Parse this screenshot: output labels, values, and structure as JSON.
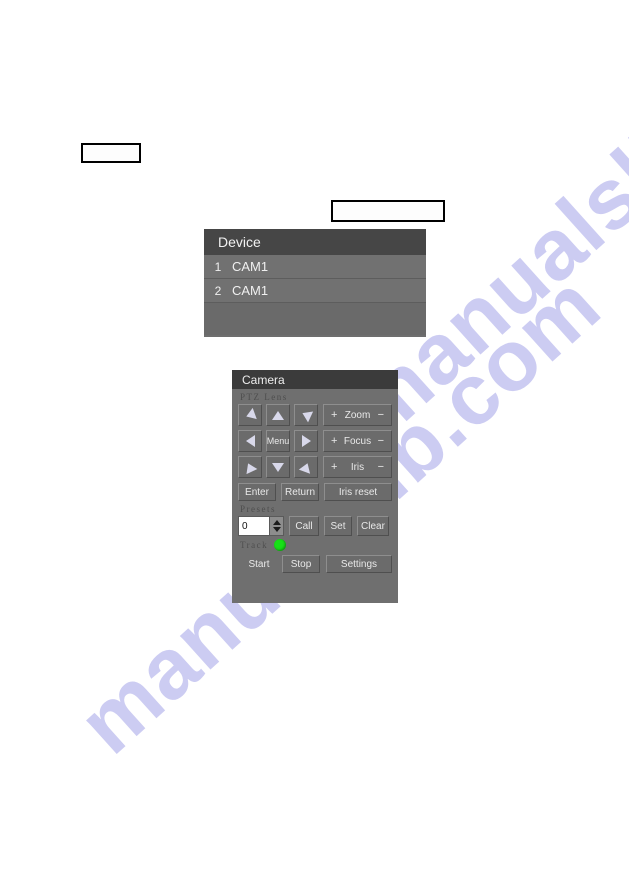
{
  "watermark": {
    "text_left": "manualslib.com",
    "text_right": "manualslib.com",
    "color": "#ccccf2"
  },
  "callouts": [
    {
      "name": "callout-box-1",
      "text": ""
    },
    {
      "name": "callout-box-2",
      "text": ""
    }
  ],
  "device_panel": {
    "title": "Device",
    "columns": [
      "",
      "Device"
    ],
    "rows": [
      {
        "num": "1",
        "name": "CAM1"
      },
      {
        "num": "2",
        "name": "CAM1"
      }
    ]
  },
  "camera_panel": {
    "title": "Camera",
    "ptz_section_label": "PTZ  Lens",
    "dpad": [
      {
        "name": "pan-up-left",
        "icon": "arrow-up-left-icon"
      },
      {
        "name": "tilt-up",
        "icon": "arrow-up-icon"
      },
      {
        "name": "pan-up-right",
        "icon": "arrow-up-right-icon"
      },
      {
        "name": "pan-left",
        "icon": "arrow-left-icon"
      },
      {
        "name": "menu",
        "label": "Menu"
      },
      {
        "name": "pan-right",
        "icon": "arrow-right-icon"
      },
      {
        "name": "pan-down-left",
        "icon": "arrow-down-left-icon"
      },
      {
        "name": "tilt-down",
        "icon": "arrow-down-icon"
      },
      {
        "name": "pan-down-right",
        "icon": "arrow-down-right-icon"
      }
    ],
    "lens_controls": [
      {
        "name": "zoom",
        "label": "Zoom",
        "plus": "+",
        "minus": "−"
      },
      {
        "name": "focus",
        "label": "Focus",
        "plus": "+",
        "minus": "−"
      },
      {
        "name": "iris",
        "label": "Iris",
        "plus": "+",
        "minus": "−"
      }
    ],
    "action_row": {
      "enter": "Enter",
      "return": "Return",
      "iris_reset": "Iris reset"
    },
    "presets": {
      "section_label": "Presets",
      "value": "0",
      "call": "Call",
      "set": "Set",
      "clear": "Clear"
    },
    "track": {
      "label": "Track",
      "led_color": "#17e017",
      "start": "Start",
      "stop": "Stop",
      "settings": "Settings"
    }
  }
}
